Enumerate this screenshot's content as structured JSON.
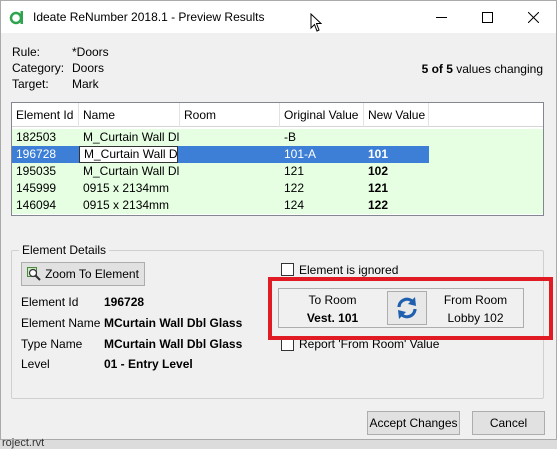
{
  "window": {
    "title": "Ideate ReNumber 2018.1 - Preview Results"
  },
  "info": {
    "rule_label": "Rule:",
    "rule_value": "*Doors",
    "category_label": "Category:",
    "category_value": "Doors",
    "target_label": "Target:",
    "target_value": "Mark",
    "changing_count": "5 of 5",
    "changing_text": " values changing"
  },
  "grid": {
    "columns": [
      "Element Id",
      "Name",
      "Room",
      "Original Value",
      "New Value"
    ],
    "rows": [
      {
        "element_id": "182503",
        "name": "M_Curtain Wall Dl",
        "room": "",
        "original": "-B",
        "new": ""
      },
      {
        "element_id": "196728",
        "name": "M_Curtain Wall Dl",
        "room": "",
        "original": "101-A",
        "new": "101"
      },
      {
        "element_id": "195035",
        "name": "M_Curtain Wall Dl",
        "room": "",
        "original": "121",
        "new": "102"
      },
      {
        "element_id": "145999",
        "name": "0915 x 2134mm",
        "room": "",
        "original": "122",
        "new": "121"
      },
      {
        "element_id": "146094",
        "name": "0915 x 2134mm",
        "room": "",
        "original": "124",
        "new": "122"
      }
    ],
    "selected_row": 1
  },
  "details": {
    "group_title": "Element Details",
    "zoom_button": "Zoom To Element",
    "element_id_label": "Element Id",
    "element_id_value": "196728",
    "element_name_label": "Element Name",
    "element_name_value": "MCurtain Wall Dbl Glass",
    "type_name_label": "Type Name",
    "type_name_value": "MCurtain Wall Dbl Glass",
    "level_label": "Level",
    "level_value": "01 - Entry Level",
    "ignored_label": "Element is ignored",
    "to_room_label": "To Room",
    "to_room_value": "Vest. 101",
    "from_room_label": "From Room",
    "from_room_value": "Lobby 102",
    "report_label": "Report 'From Room' Value"
  },
  "buttons": {
    "accept": "Accept Changes",
    "cancel": "Cancel"
  },
  "background": {
    "text": "roject.rvt"
  },
  "colors": {
    "row_green": "#e6ffe3",
    "selection_blue": "#3d7fd6",
    "highlight_red": "#e01b24"
  },
  "icons": [
    "app-icon",
    "mouse-cursor-icon",
    "minimize-icon",
    "maximize-icon",
    "close-icon",
    "zoom-icon",
    "swap-icon"
  ]
}
